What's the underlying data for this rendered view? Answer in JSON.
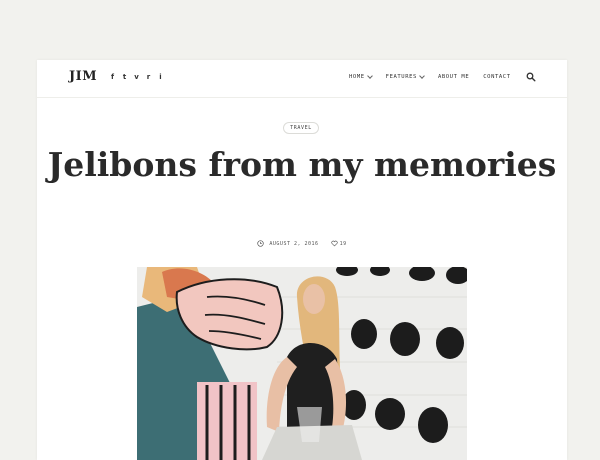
{
  "header": {
    "logo": "JIM",
    "social_icons": [
      "facebook-icon",
      "twitter-icon",
      "vimeo-icon",
      "reddit-icon",
      "instagram-icon"
    ],
    "social_glyphs": [
      "f",
      "t",
      "v",
      "r",
      "i"
    ],
    "nav": [
      {
        "label": "HOME",
        "has_dropdown": true
      },
      {
        "label": "FEATURES",
        "has_dropdown": true
      },
      {
        "label": "ABOUT ME",
        "has_dropdown": false
      },
      {
        "label": "CONTACT",
        "has_dropdown": false
      }
    ]
  },
  "post": {
    "category": "TRAVEL",
    "title": "Jelibons from my memories",
    "date": "AUGUST 2, 2016",
    "likes": "19"
  },
  "colors": {
    "background": "#f2f2ee",
    "card": "#ffffff",
    "text": "#2a2a2a"
  }
}
